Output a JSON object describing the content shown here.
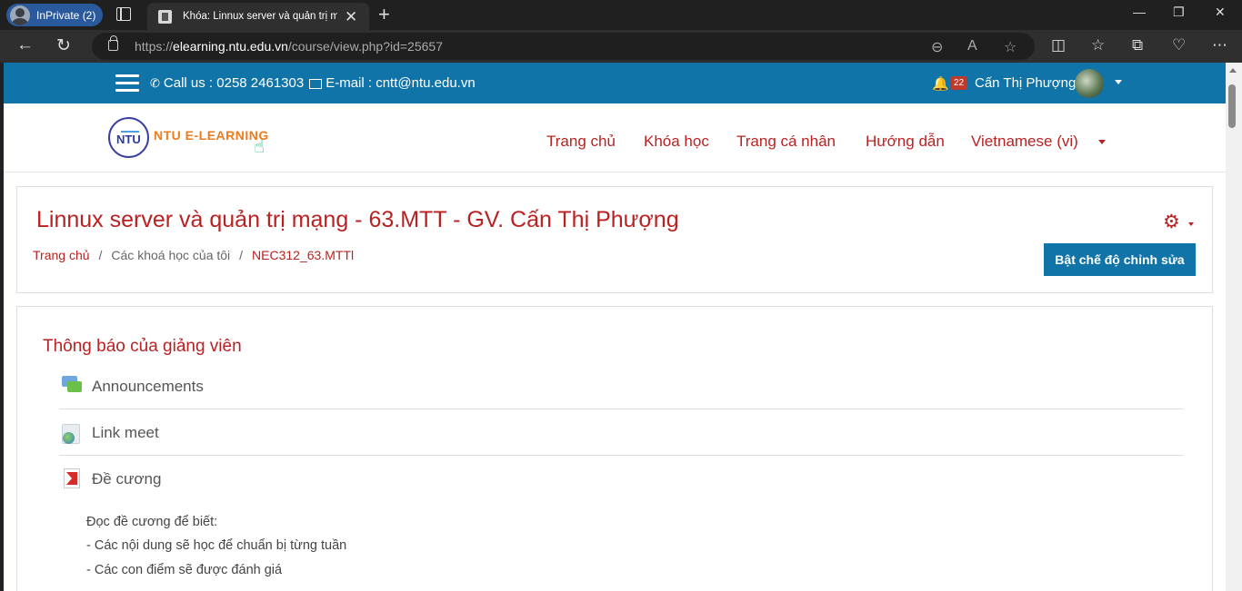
{
  "browser": {
    "inprivate_label": "InPrivate (2)",
    "tab_title": "Khóa: Linnux server và quản trị m",
    "url_host": "elearning.ntu.edu.vn",
    "url_path": "/course/view.php?id=25657",
    "url_scheme": "https://"
  },
  "topbar": {
    "phone": "Call us : 0258 2461303",
    "email": "E-mail : cntt@ntu.edu.vn",
    "notification_count": "22",
    "user_name": "Cấn Thị Phượng"
  },
  "header": {
    "logo_text": "NTU E-LEARNING",
    "logo_badge": "NTU",
    "nav": [
      "Trang chủ",
      "Khóa học",
      "Trang cá nhân",
      "Hướng dẫn",
      "Vietnamese (vi)"
    ]
  },
  "course": {
    "title": "Linnux server và quản trị mạng - 63.MTT - GV. Cấn Thị Phượng",
    "breadcrumb": [
      "Trang chủ",
      "Các khoá học của tôi",
      "NEC312_63.MTTl"
    ],
    "edit_button": "Bật chế độ chỉnh sửa"
  },
  "section": {
    "title": "Thông báo của giảng viên",
    "activities": [
      {
        "name": "Announcements",
        "icon": "forum-icon"
      },
      {
        "name": "Link meet",
        "icon": "url-icon"
      },
      {
        "name": "Đề cương",
        "icon": "pdf-icon"
      }
    ],
    "description": [
      "Đọc đề cương để biết:",
      "- Các nội dung sẽ học để chuẩn bị từng tuần",
      "- Các con điểm sẽ được đánh giá"
    ]
  },
  "colors": {
    "brand_blue": "#1174a8",
    "accent_red": "#b82222"
  }
}
